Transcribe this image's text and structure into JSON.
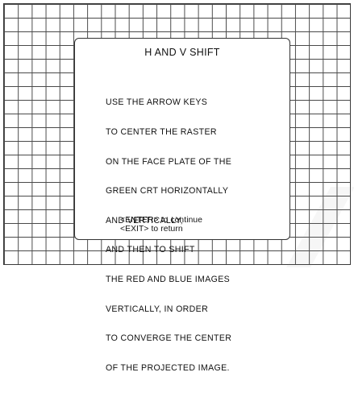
{
  "dialog": {
    "title": "H AND V SHIFT",
    "instruction_lines": [
      "USE THE ARROW KEYS",
      "TO CENTER THE RASTER",
      "ON THE FACE PLATE OF THE",
      "GREEN CRT HORIZONTALLY",
      "AND VERTICALLY,",
      "AND THEN TO SHIFT",
      "THE RED AND BLUE IMAGES",
      "VERTICALLY, IN ORDER",
      "TO CONVERGE THE CENTER",
      "OF THE PROJECTED IMAGE."
    ],
    "enter_hint": "<ENTER> to continue",
    "exit_hint": "<EXIT> to return"
  },
  "colors": {
    "background": "#ffffff",
    "grid_lines": "#4a4a4a",
    "dialog_border": "#333333",
    "text": "#111111"
  }
}
